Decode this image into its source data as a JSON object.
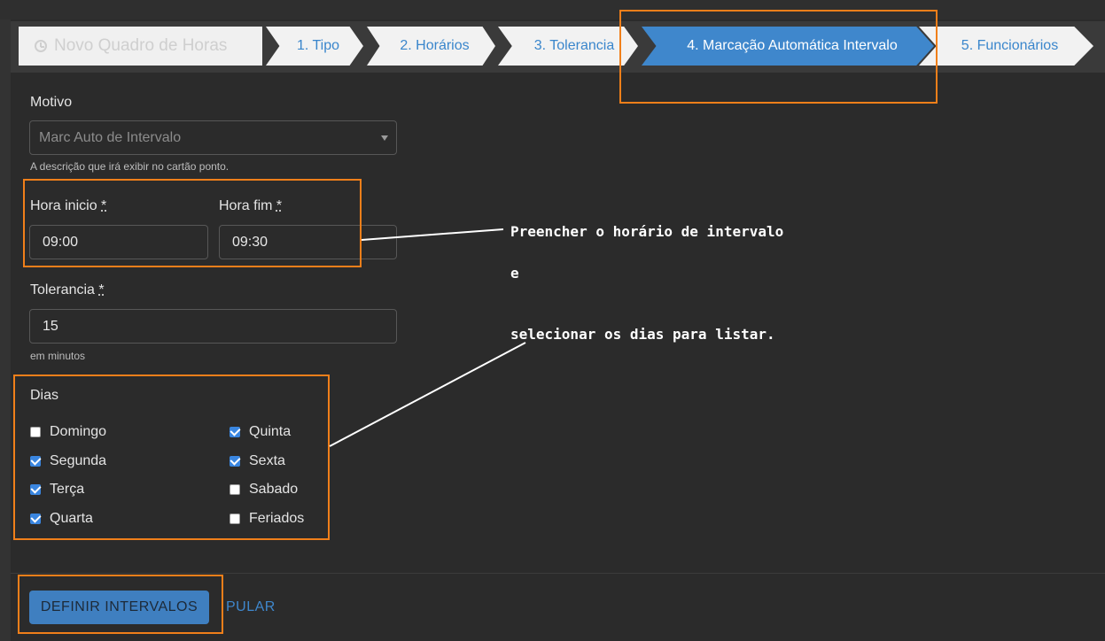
{
  "wizard": {
    "title": "Novo Quadro de Horas",
    "steps": [
      {
        "label": "1. Tipo"
      },
      {
        "label": "2. Horários"
      },
      {
        "label": "3. Tolerancia"
      },
      {
        "label": "4. Marcação Automática Intervalo"
      },
      {
        "label": "5. Funcionários"
      }
    ],
    "active_step_index": 3
  },
  "form": {
    "motivo": {
      "label": "Motivo",
      "value": "Marc Auto de Intervalo",
      "help": "A descrição que irá exibir no cartão ponto."
    },
    "hora_inicio": {
      "label": "Hora inicio",
      "required": "*",
      "value": "09:00"
    },
    "hora_fim": {
      "label": "Hora fim",
      "required": "*",
      "value": "09:30"
    },
    "tolerancia": {
      "label": "Tolerancia",
      "required": "*",
      "value": "15",
      "help": "em minutos"
    },
    "dias": {
      "label": "Dias",
      "options": [
        {
          "label": "Domingo",
          "checked": false
        },
        {
          "label": "Segunda",
          "checked": true
        },
        {
          "label": "Terça",
          "checked": true
        },
        {
          "label": "Quarta",
          "checked": true
        },
        {
          "label": "Quinta",
          "checked": true
        },
        {
          "label": "Sexta",
          "checked": true
        },
        {
          "label": "Sabado",
          "checked": false
        },
        {
          "label": "Feriados",
          "checked": false
        }
      ]
    }
  },
  "actions": {
    "primary": "DEFINIR INTERVALOS",
    "skip": "PULAR"
  },
  "annotation": {
    "line1": "Preencher o horário de intervalo",
    "line2": "e",
    "line3": "selecionar os dias para listar."
  },
  "colors": {
    "highlight": "#f07f1a",
    "accent": "#3f87cc",
    "background": "#2b2b2b"
  }
}
